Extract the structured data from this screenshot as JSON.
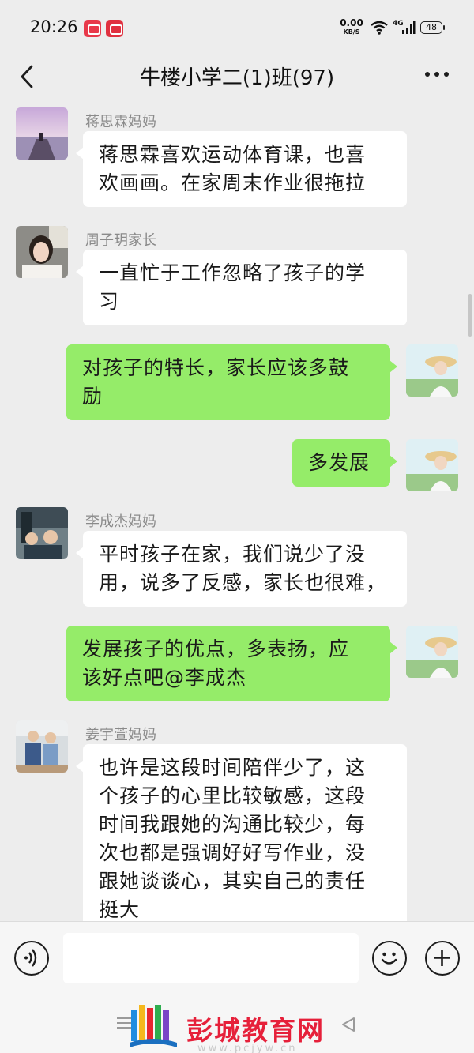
{
  "status_bar": {
    "time": "20:26",
    "net_speed_value": "0.00",
    "net_speed_unit": "KB/S",
    "network": "4G",
    "battery": "48"
  },
  "header": {
    "title": "牛楼小学二(1)班(97)",
    "back_icon": "chevron-left-icon",
    "more_icon": "more-dots-icon"
  },
  "messages": [
    {
      "direction": "in",
      "sender": "蒋思霖妈妈",
      "lines": [
        "蒋思霖喜欢运动体育课，也喜",
        "欢画画。在家周末作业很拖拉"
      ]
    },
    {
      "direction": "in",
      "sender": "周子玥家长",
      "lines": [
        "一直忙于工作忽略了孩子的学",
        "习"
      ]
    },
    {
      "direction": "out",
      "lines": [
        "对孩子的特长，家长应该多鼓",
        "励"
      ]
    },
    {
      "direction": "out",
      "lines": [
        "多发展"
      ]
    },
    {
      "direction": "in",
      "sender": "李成杰妈妈",
      "lines": [
        "平时孩子在家，我们说少了没",
        "用，说多了反感，家长也很难，"
      ]
    },
    {
      "direction": "out",
      "lines": [
        "发展孩子的优点，多表扬，应",
        "该好点吧@李成杰"
      ]
    },
    {
      "direction": "in",
      "sender": "姜宇萱妈妈",
      "lines": [
        "也许是这段时间陪伴少了，这",
        "个孩子的心里比较敏感，这段",
        "时间我跟她的沟通比较少，每",
        "次也都是强调好好写作业，没",
        "跟她谈谈心，其实自己的责任",
        "挺大"
      ]
    }
  ],
  "input_bar": {
    "voice_icon": "voice-icon",
    "input_value": "",
    "emoji_icon": "emoji-icon",
    "plus_icon": "plus-icon"
  },
  "watermark": {
    "brand": "彭城教育网",
    "url": "www.pcjyw.cn"
  },
  "colors": {
    "background": "#ededed",
    "bubble_out": "#95ec69",
    "bubble_in": "#ffffff",
    "brand_red": "#e6203a"
  }
}
